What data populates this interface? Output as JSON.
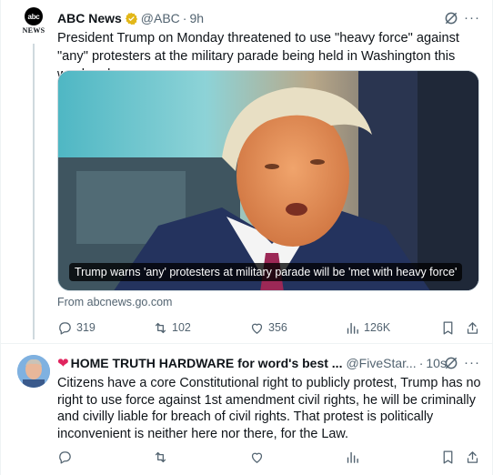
{
  "tweet1": {
    "avatar_logo_text": "abc",
    "avatar_sub_text": "NEWS",
    "name": "ABC News",
    "handle": "@ABC",
    "separator": "·",
    "time": "9h",
    "more_label": "···",
    "text": "President Trump on Monday threatened to use \"heavy force\" against \"any\" protesters at the military parade being held in Washington this weekend.",
    "media_caption": "Trump warns 'any' protesters at military parade will be 'met with heavy force'",
    "source": "From abcnews.go.com",
    "replies": "319",
    "reposts": "102",
    "likes": "356",
    "views": "126K"
  },
  "tweet2": {
    "name": "HOME TRUTH HARDWARE for word's best ...",
    "handle": "@FiveStar...",
    "separator": "·",
    "time": "10s",
    "more_label": "···",
    "text": "Citizens have a core Constitutional right to publicly protest, Trump has no right to use force against 1st amendment civil rights, he will be criminally and civilly liable for breach of civil rights. That protest is politically inconvenient is neither here nor there, for the Law."
  },
  "icons": {
    "verified": "verified-badge-icon",
    "grok": "grok-icon",
    "reply": "reply-icon",
    "repost": "repost-icon",
    "like": "heart-icon",
    "views": "views-icon",
    "bookmark": "bookmark-icon",
    "share": "share-icon"
  },
  "colors": {
    "text_primary": "#0f1419",
    "text_secondary": "#536471",
    "verified_gold": "#e2b719",
    "divider": "#eff3f4"
  }
}
